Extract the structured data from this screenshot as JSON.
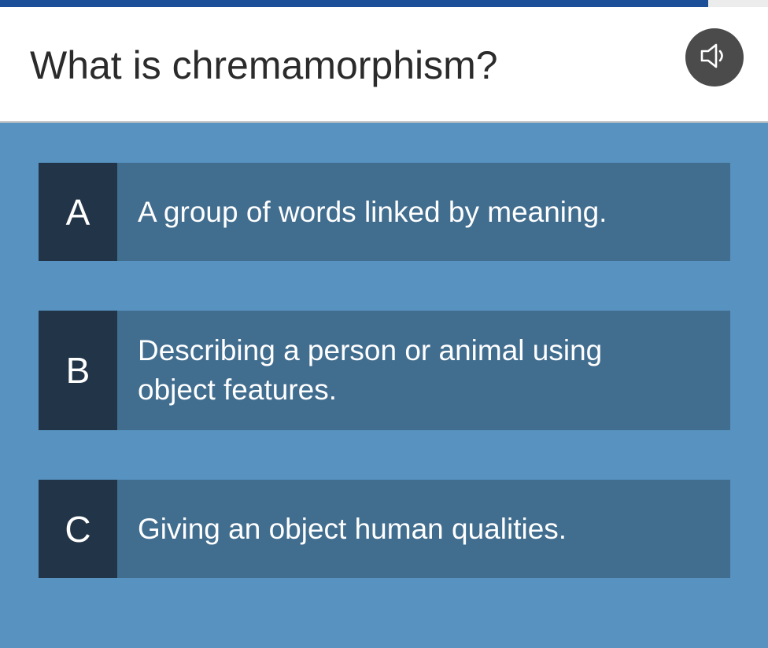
{
  "progress": {
    "fraction": 0.922
  },
  "question": {
    "text": "What is chremamorphism?",
    "audio_icon": "speaker-icon"
  },
  "answers": [
    {
      "letter": "A",
      "text": "A group of words linked by meaning."
    },
    {
      "letter": "B",
      "text": "Describing a person or animal using object features."
    },
    {
      "letter": "C",
      "text": "Giving an object human qualities."
    }
  ],
  "colors": {
    "background": "#5792c0",
    "answer_bg": "#416d8f",
    "letter_bg": "#223447",
    "progress": "#1d4f99"
  }
}
